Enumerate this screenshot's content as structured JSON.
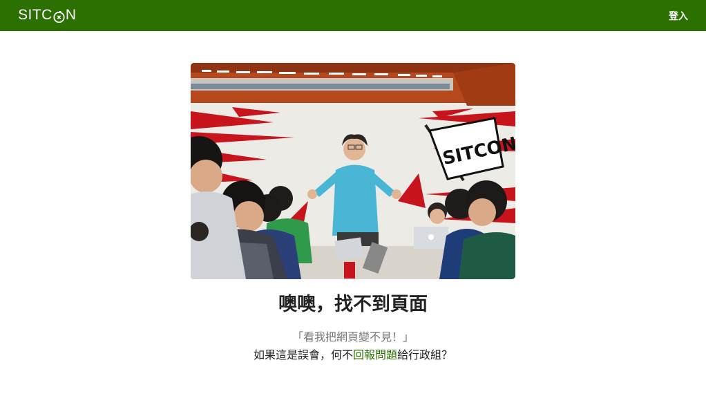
{
  "navbar": {
    "logo_text_left": "SITC",
    "logo_text_right": "N",
    "login_label": "登入",
    "background_color": "#2b7000"
  },
  "hero_image": {
    "banner_text": "SITCON"
  },
  "error": {
    "title": "噢噢，找不到頁面",
    "quote": "「看我把網頁變不見！」",
    "message_before": "如果這是誤會，何不",
    "report_link": "回報問題",
    "message_after": "給行政組？",
    "link_color": "#2b7000"
  }
}
